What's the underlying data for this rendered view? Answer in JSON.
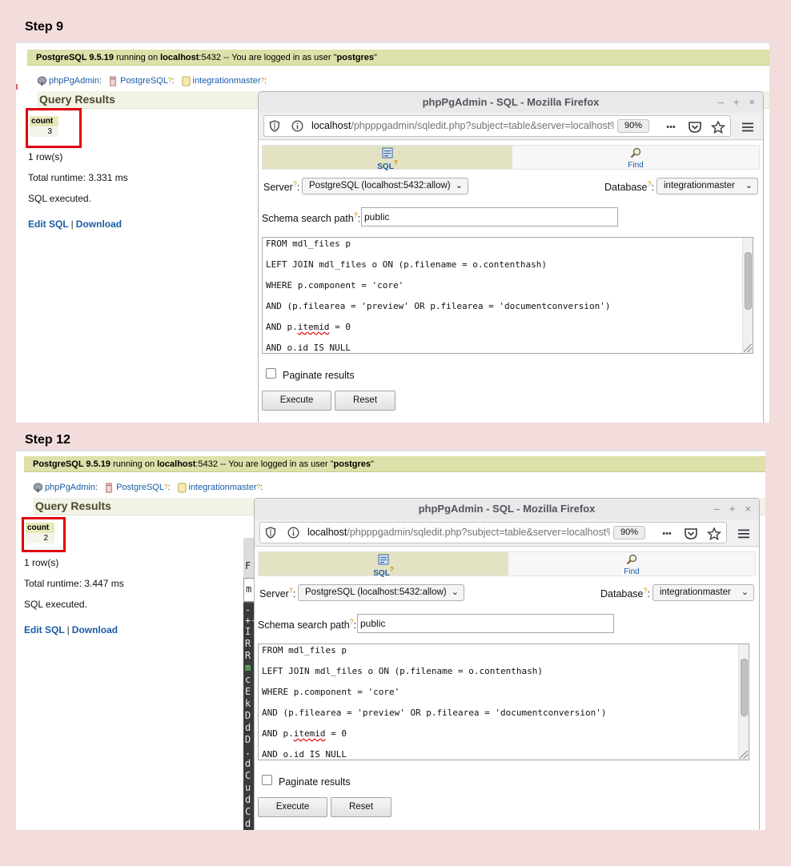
{
  "step9": {
    "heading": "Step 9",
    "topbar": {
      "version": "PostgreSQL 9.5.19",
      "running_on": " running on ",
      "host": "localhost",
      "rest": ":5432 -- You are logged in as user \"",
      "user": "postgres",
      "end": "\""
    },
    "breadcrumb": {
      "app": "phpPgAdmin",
      "server": "PostgreSQL",
      "db": "integrationmaster",
      "q": "?",
      "sep": ":"
    },
    "query_results_title": "Query Results",
    "result": {
      "column": "count",
      "value": "3"
    },
    "rows": "1 row(s)",
    "runtime": "Total runtime: 3.331 ms",
    "executed": "SQL executed.",
    "links": {
      "edit": "Edit SQL",
      "download": "Download",
      "sep": "|"
    }
  },
  "step12": {
    "heading": "Step 12",
    "topbar": {
      "version": "PostgreSQL 9.5.19",
      "running_on": " running on ",
      "host": "localhost",
      "rest": ":5432 -- You are logged in as user \"",
      "user": "postgres",
      "end": "\""
    },
    "breadcrumb": {
      "app": "phpPgAdmin",
      "server": "PostgreSQL",
      "db": "integrationmaster",
      "q": "?",
      "sep": ":"
    },
    "query_results_title": "Query Results",
    "result": {
      "column": "count",
      "value": "2"
    },
    "rows": "1 row(s)",
    "runtime": "Total runtime: 3.447 ms",
    "executed": "SQL executed.",
    "links": {
      "edit": "Edit SQL",
      "download": "Download",
      "sep": "|"
    },
    "terminal_lines": [
      "F",
      "m",
      "-",
      "+-",
      "I",
      "R",
      "R",
      "m",
      "c",
      "E",
      "k",
      "D",
      "d",
      "D",
      ".",
      "d",
      "C",
      "u",
      "d",
      "C",
      "d"
    ]
  },
  "firefox": {
    "title": "phpPgAdmin - SQL - Mozilla Firefox",
    "controls": {
      "minimize": "–",
      "maximize": "+",
      "close": "×"
    },
    "url_host": "localhost",
    "url_path": "/phpppgadmin/sqledit.php?subject=table&server=localhost%",
    "zoom": "90%",
    "menu_dots": "•••",
    "tabs": {
      "sql": "SQL",
      "find": "Find",
      "q": "?"
    },
    "server_label": "Server",
    "server_value": "PostgreSQL (localhost:5432:allow)",
    "database_label": "Database",
    "database_value": "integrationmaster",
    "schema_label": "Schema search path",
    "schema_value": "public",
    "q": "?",
    "colon": ":",
    "sql_lines": [
      "FROM mdl_files p",
      "LEFT JOIN mdl_files o ON (p.filename = o.contenthash)",
      "WHERE p.component = 'core'",
      "AND (p.filearea = 'preview' OR p.filearea = 'documentconversion')",
      "AND p.",
      "itemid",
      " = 0",
      "AND o.id IS NULL"
    ],
    "paginate_label": "Paginate results",
    "execute_label": "Execute",
    "reset_label": "Reset"
  },
  "colors": {
    "background": "#f2dcdc",
    "topbar": "#dde0a8",
    "highlight": "#e00010",
    "link": "#1a5ca8"
  }
}
